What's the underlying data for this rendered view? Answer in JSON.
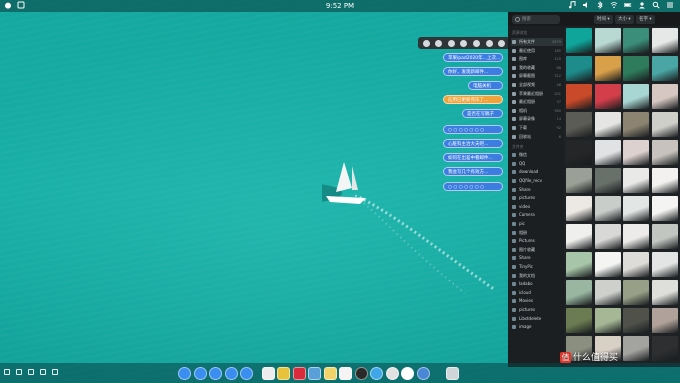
{
  "topbar": {
    "clock": "9:52 PM",
    "left_icons": [
      "apple-icon",
      "finder-icon"
    ],
    "right_icons": [
      "music-icon",
      "volume-icon",
      "bluetooth-icon",
      "wifi-icon",
      "battery-icon",
      "user-icon",
      "search-icon",
      "list-icon"
    ]
  },
  "float_toolbar": {
    "icons": [
      "settings-icon",
      "edit-icon",
      "sort-icon",
      "plus-icon",
      "eye-icon",
      "search-icon",
      "arrow-icon"
    ]
  },
  "notifications": [
    {
      "text": "苹果ipad2020年...上次...",
      "style": "blue"
    },
    {
      "text": "你好，发现新邮件...",
      "style": "blue"
    },
    {
      "text": "电脑关机",
      "style": "blue"
    },
    {
      "text": "应用已更新完毕了...",
      "style": "orange"
    },
    {
      "text": "是否在写稿子",
      "style": "blue"
    },
    {
      "text": "○ ○ ○ ○ ○ ○ ○",
      "style": "blue"
    },
    {
      "text": "心脏科主治大夫吧...",
      "style": "blue"
    },
    {
      "text": "如何在出差中看邮件...",
      "style": "blue"
    },
    {
      "text": "我会写几个有效方...",
      "style": "blue"
    },
    {
      "text": "○ ○ ○ ○ ○ ○ ○",
      "style": "blue"
    }
  ],
  "panel": {
    "search_placeholder": "搜索",
    "top_pills": [
      "时间 ▾",
      "大小 ▾",
      "名字 ▾"
    ],
    "section_a": "资源浏览",
    "items_a": [
      {
        "label": "所有文件",
        "count": "2879"
      },
      {
        "label": "最近使用",
        "count": "185"
      },
      {
        "label": "图库",
        "count": "120"
      },
      {
        "label": "我的收藏",
        "count": "86"
      },
      {
        "label": "屏幕截图",
        "count": "312"
      },
      {
        "label": "全部视频",
        "count": "48"
      },
      {
        "label": "苹果最近相册",
        "count": "201"
      },
      {
        "label": "最近相册",
        "count": "37"
      },
      {
        "label": "相机",
        "count": "560"
      },
      {
        "label": "屏幕录像",
        "count": "14"
      },
      {
        "label": "下载",
        "count": "92"
      },
      {
        "label": "回收站",
        "count": "6"
      }
    ],
    "section_b": "文件夹",
    "items_b": [
      "微信",
      "QQ",
      "download",
      "QQfile_recv",
      "Share",
      "pictures",
      "video",
      "Camera",
      "pic",
      "相册",
      "Pictures",
      "图片收藏",
      "Share",
      "TinyPic",
      "我的文档",
      "Iadabo",
      "icloud",
      "Movies",
      "pictures",
      "Libstdelete",
      "image"
    ]
  },
  "thumbs": [
    "#0fa59a",
    "#b8d8d2",
    "#3b8f7a",
    "#e6e8e7",
    "#1d8c8a",
    "#d9a04a",
    "#2e7c5c",
    "#4aa6a4",
    "#c94a2a",
    "#d23e4a",
    "#a8d6d2",
    "#d6c7c2",
    "#5c5c56",
    "#e5e6e3",
    "#8c8470",
    "#cfcfca",
    "#252628",
    "#e1e2e4",
    "#dcd1cf",
    "#c7c2bd",
    "#9aa095",
    "#68706a",
    "#e9e9e7",
    "#f2f1ef",
    "#ece8e3",
    "#c9cdca",
    "#e2e6e5",
    "#f4f4f2",
    "#efefed",
    "#d8d8d6",
    "#ecebe9",
    "#c2c6c1",
    "#a7c5a8",
    "#f4f5f3",
    "#dddcd8",
    "#e3e5e4",
    "#98b6a0",
    "#cdd0cb",
    "#97a087",
    "#dedfdb",
    "#6b7c52",
    "#a6b795",
    "#50524a",
    "#b0a29a",
    "#8a8f80",
    "#d8cfc5",
    "#a3a3a0",
    "#2d2f31"
  ],
  "dock": {
    "left_icons": [
      "window-icon",
      "copy-icon",
      "crop-icon",
      "trash-small-icon",
      "screen-icon"
    ],
    "apps": [
      {
        "name": "launcher-icon",
        "color": "#3a8ef0",
        "round": true
      },
      {
        "name": "camera-app-icon",
        "color": "#3a8ef0",
        "round": true
      },
      {
        "name": "video-app-icon",
        "color": "#3a8ef0",
        "round": true
      },
      {
        "name": "mail-app-icon",
        "color": "#3a8ef0",
        "round": true
      },
      {
        "name": "notes-app-icon",
        "color": "#3a8ef0",
        "round": true
      },
      {
        "name": "finder-app-icon",
        "color": "#ececec",
        "round": false
      },
      {
        "name": "photos-app-icon",
        "color": "#e7c23a",
        "round": false
      },
      {
        "name": "music-app-icon",
        "color": "#d92b3b",
        "round": false
      },
      {
        "name": "maps-app-icon",
        "color": "#5aa0d8",
        "round": false
      },
      {
        "name": "pages-app-icon",
        "color": "#f1d36a",
        "round": false
      },
      {
        "name": "calendar-app-icon",
        "color": "#f4f4f4",
        "round": false
      },
      {
        "name": "clock-app-icon",
        "color": "#2a2a2a",
        "round": true
      },
      {
        "name": "safari-app-icon",
        "color": "#3fa6e8",
        "round": true
      },
      {
        "name": "chrome-app-icon",
        "color": "#e2e2e2",
        "round": true
      },
      {
        "name": "cloud-app-icon",
        "color": "#ffffff",
        "round": true
      },
      {
        "name": "weather-app-icon",
        "color": "#4a87d6",
        "round": true
      },
      {
        "name": "trash-app-icon",
        "color": "#cfd6d8",
        "round": false
      }
    ]
  },
  "watermark": {
    "badge": "值",
    "text": "什么值得买"
  }
}
